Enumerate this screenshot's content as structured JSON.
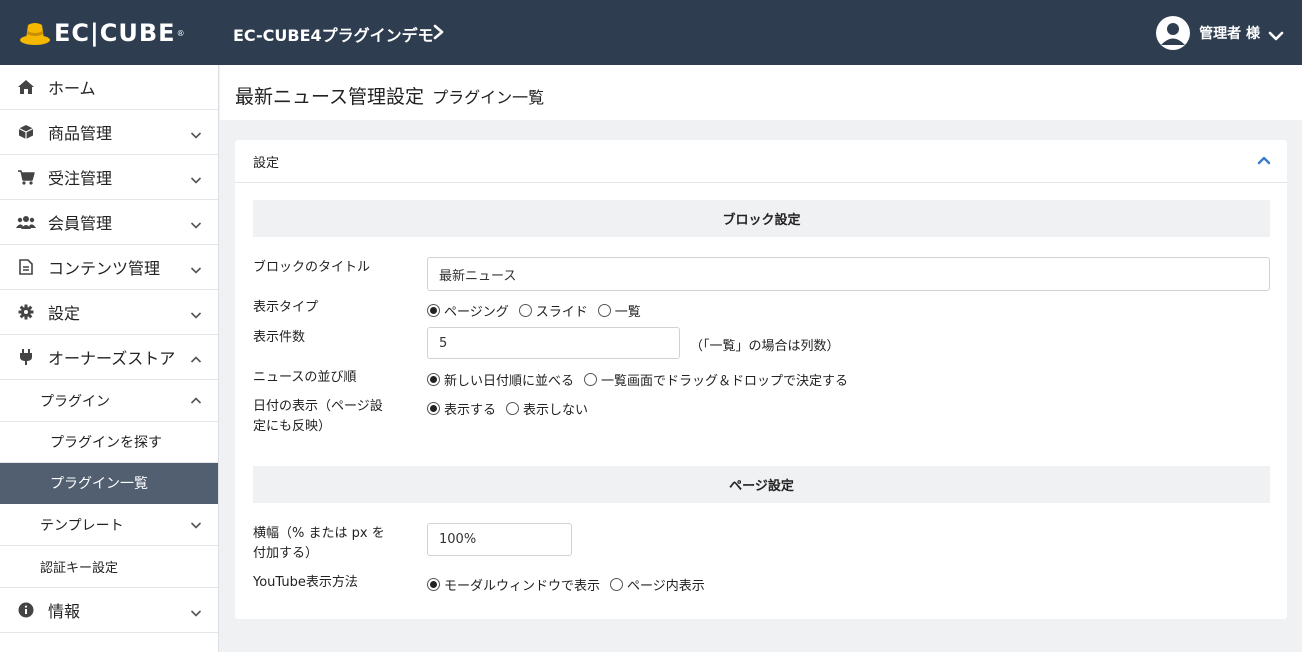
{
  "header": {
    "logo_text": "EC|CUBE",
    "logo_mark": "®",
    "shop_name": "EC-CUBE4プラグインデモ",
    "user_name": "管理者 様"
  },
  "sidebar": {
    "items": [
      {
        "label": "ホーム",
        "icon": "home-icon"
      },
      {
        "label": "商品管理",
        "icon": "cube-icon"
      },
      {
        "label": "受注管理",
        "icon": "cart-icon"
      },
      {
        "label": "会員管理",
        "icon": "users-icon"
      },
      {
        "label": "コンテンツ管理",
        "icon": "document-icon"
      },
      {
        "label": "設定",
        "icon": "gear-icon"
      },
      {
        "label": "オーナーズストア",
        "icon": "plug-icon"
      }
    ],
    "plugin_label": "プラグイン",
    "plugin_search": "プラグインを探す",
    "plugin_list": "プラグイン一覧",
    "template_label": "テンプレート",
    "auth_key": "認証キー設定",
    "info_label": "情報"
  },
  "page": {
    "title": "最新ニュース管理設定",
    "subtitle": "プラグイン一覧"
  },
  "card": {
    "header": "設定",
    "block_section": "ブロック設定",
    "page_section": "ページ設定",
    "block_title_label": "ブロックのタイトル",
    "block_title_value": "最新ニュース",
    "display_type_label": "表示タイプ",
    "display_type_options": [
      "ページング",
      "スライド",
      "一覧"
    ],
    "display_count_label": "表示件数",
    "display_count_value": "5",
    "display_count_note": "（「一覧」の場合は列数）",
    "sort_label": "ニュースの並び順",
    "sort_options": [
      "新しい日付順に並べる",
      "一覧画面でドラッグ＆ドロップで決定する"
    ],
    "date_label_1": "日付の表示（ページ設",
    "date_label_2": "定にも反映）",
    "date_options": [
      "表示する",
      "表示しない"
    ],
    "width_label_1": "横幅（% または px を",
    "width_label_2": "付加する）",
    "width_value": "100%",
    "youtube_label": "YouTube表示方法",
    "youtube_options": [
      "モーダルウィンドウで表示",
      "ページ内表示"
    ]
  },
  "colors": {
    "header_bg": "#2e3d4f",
    "active_bg": "#515f70",
    "accent": "#3a7bc8",
    "logo_yellow": "#f5b800"
  }
}
